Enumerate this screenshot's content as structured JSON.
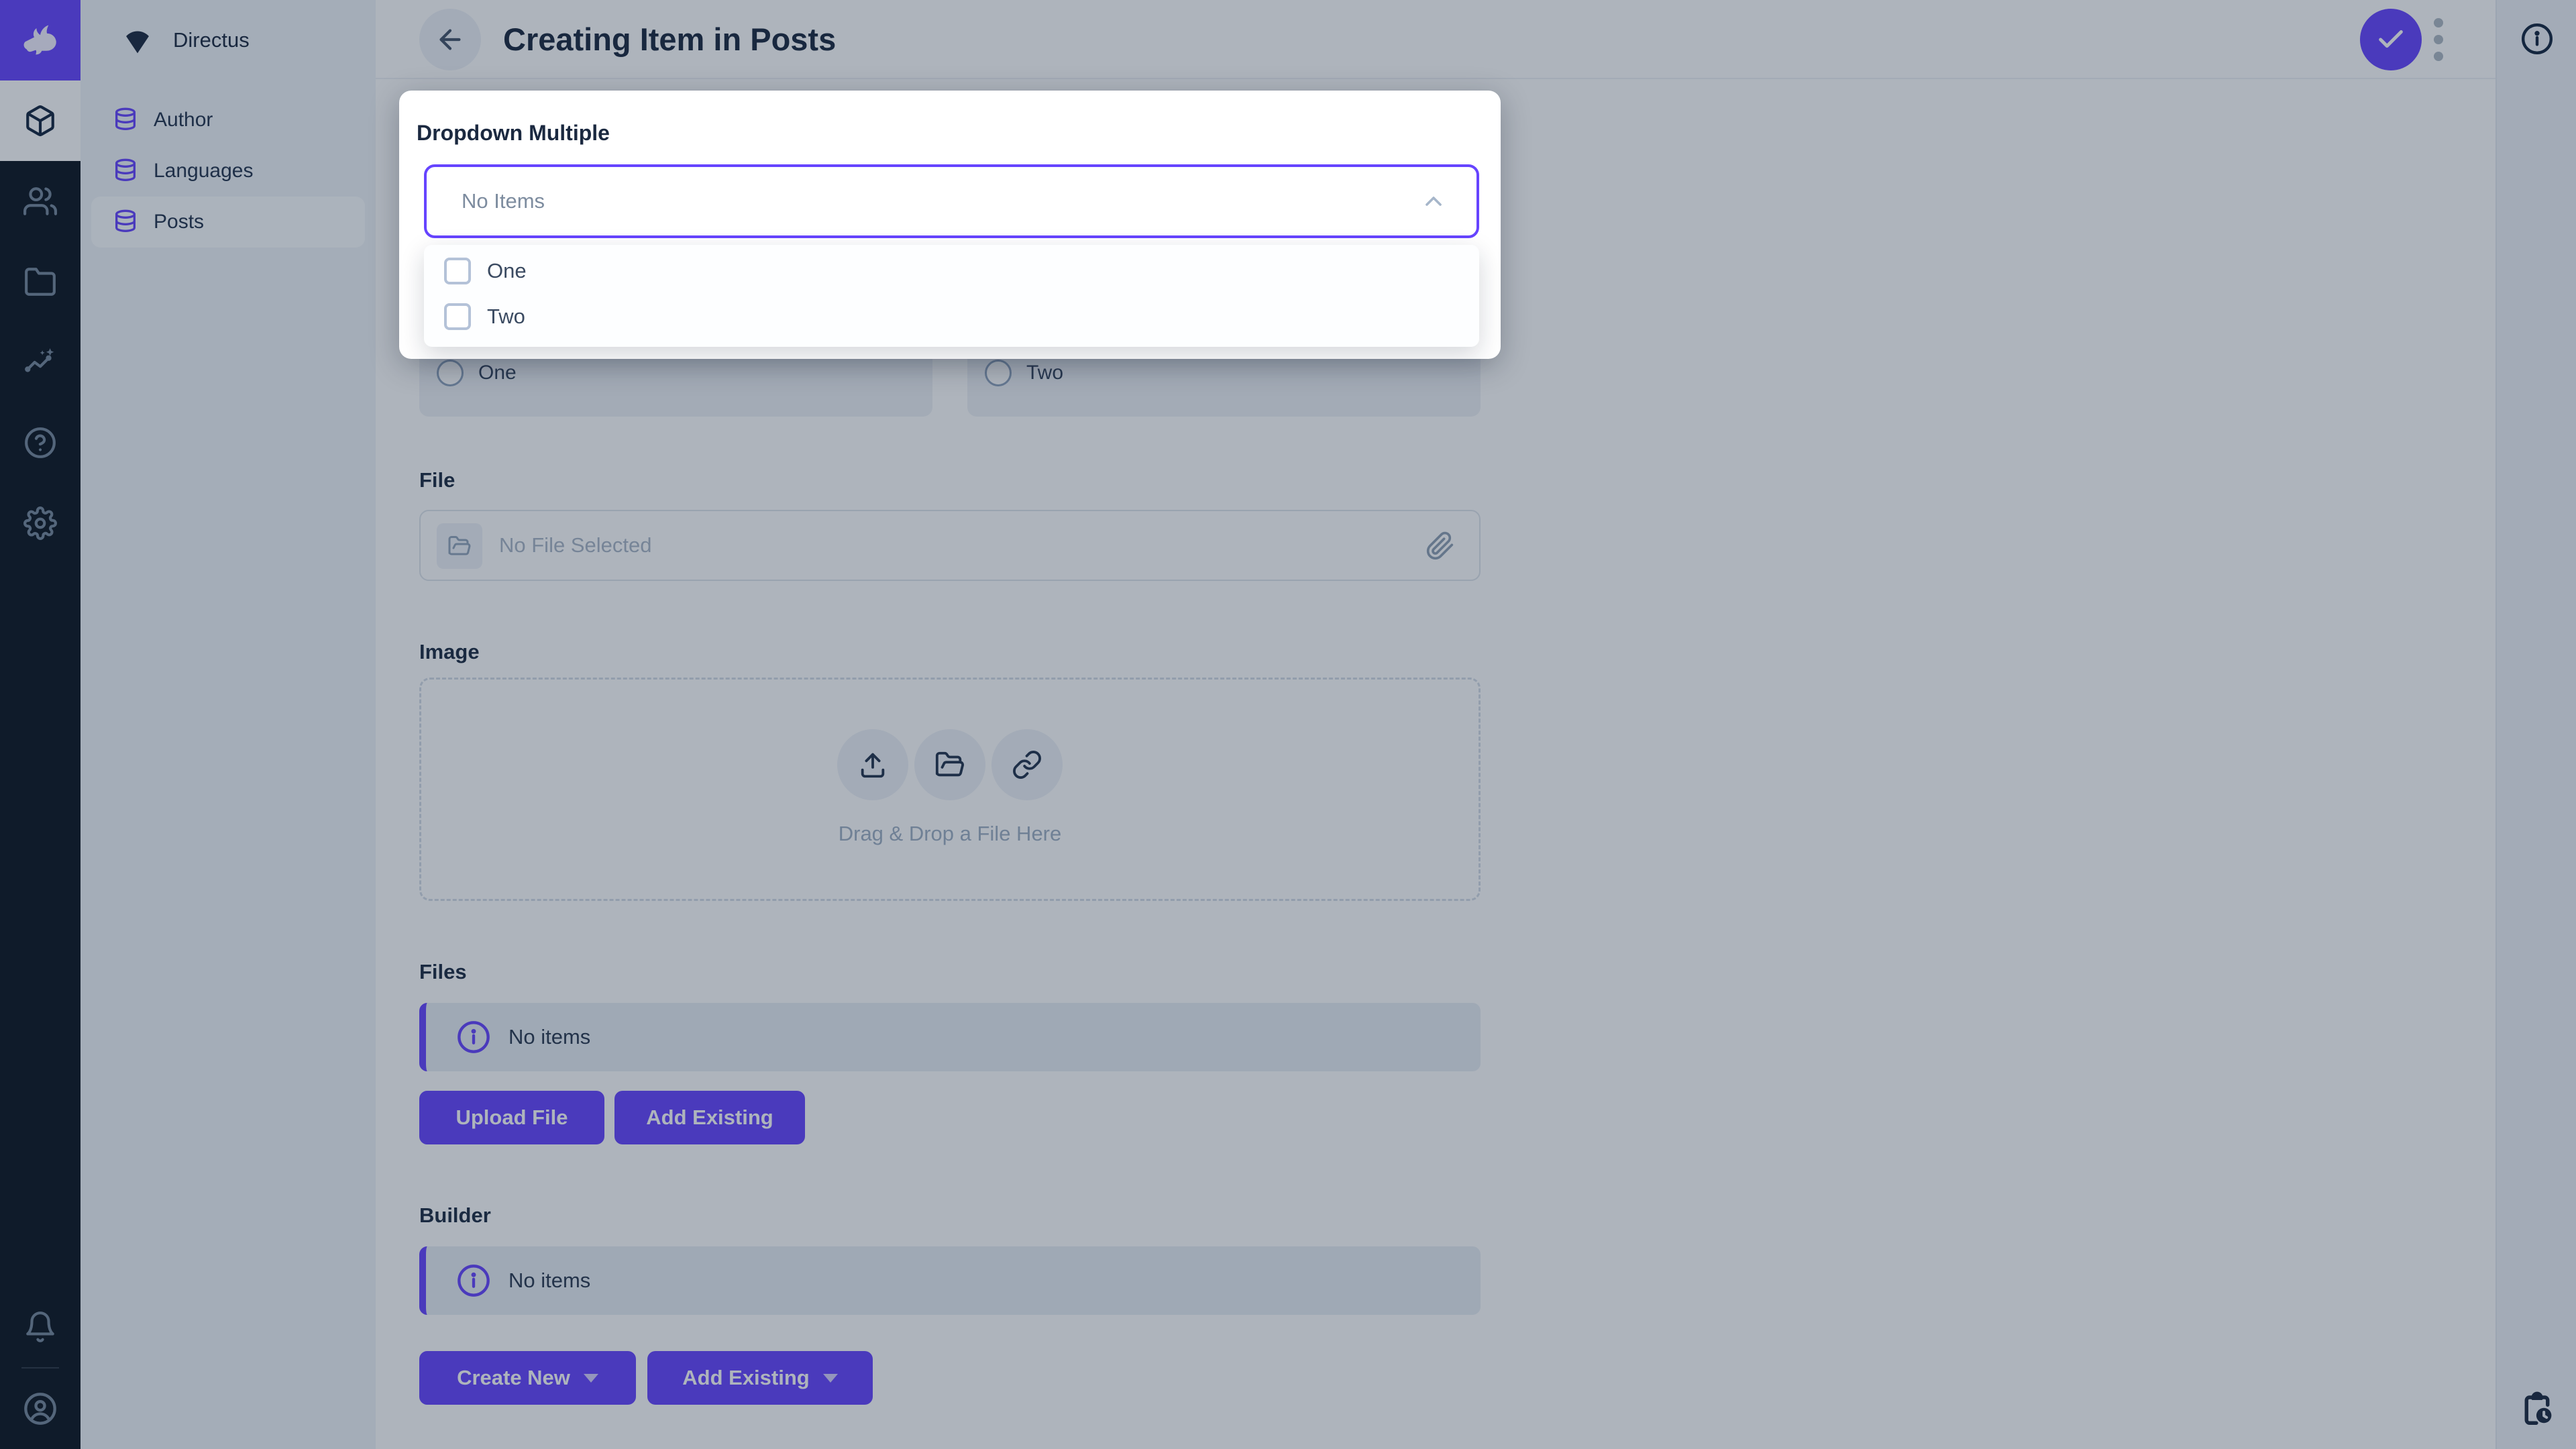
{
  "colors": {
    "accent": "#6644ff",
    "module_bar_bg": "#0b141f",
    "nav_bg": "#f0f4f9",
    "overlay": "rgba(23,41,64,0.35)",
    "foreground": "#1b2940",
    "subdued": "#a2b5cd"
  },
  "module_bar": {
    "logo_icon": "rabbit-logo",
    "modules": [
      {
        "icon": "box-icon",
        "active": true
      },
      {
        "icon": "users-icon",
        "active": false
      },
      {
        "icon": "folder-icon",
        "active": false
      },
      {
        "icon": "insights-icon",
        "active": false
      },
      {
        "icon": "help-icon",
        "active": false
      },
      {
        "icon": "settings-icon",
        "active": false
      }
    ],
    "bottom": [
      {
        "icon": "bell-icon"
      },
      {
        "icon": "user-circle-icon"
      }
    ]
  },
  "nav": {
    "project_name": "Directus",
    "project_icon": "fan-shield-icon",
    "items": [
      {
        "label": "Author",
        "icon": "database-icon",
        "active": false
      },
      {
        "label": "Languages",
        "icon": "database-icon",
        "active": false
      },
      {
        "label": "Posts",
        "icon": "database-icon",
        "active": true
      }
    ]
  },
  "header": {
    "title": "Creating Item in Posts",
    "back_icon": "arrow-left-icon",
    "save_icon": "check-icon",
    "more_icon": "more-vertical-icon"
  },
  "dropdown_modal": {
    "label": "Dropdown Multiple",
    "value": "No Items",
    "chevron": "chevron-up-icon",
    "options": [
      {
        "label": "One",
        "checked": false
      },
      {
        "label": "Two",
        "checked": false
      }
    ]
  },
  "form": {
    "radio_group": {
      "options": [
        {
          "label": "One",
          "selected": false
        },
        {
          "label": "Two",
          "selected": false
        }
      ]
    },
    "file": {
      "label": "File",
      "placeholder": "No File Selected",
      "left_icon": "folder-open-icon",
      "right_icon": "paperclip-icon"
    },
    "image": {
      "label": "Image",
      "dropzone_text": "Drag & Drop a File Here",
      "buttons": [
        "upload-icon",
        "folder-open-icon",
        "link-icon"
      ]
    },
    "files": {
      "label": "Files",
      "notice": "No items",
      "notice_icon": "info-icon",
      "upload_button": "Upload File",
      "add_button": "Add Existing"
    },
    "builder": {
      "label": "Builder",
      "notice": "No items",
      "notice_icon": "info-icon",
      "create_button": "Create New",
      "add_button": "Add Existing"
    }
  },
  "right_sidebar": {
    "top_icon": "info-icon",
    "bottom_icon": "clipboard-clock-icon"
  }
}
